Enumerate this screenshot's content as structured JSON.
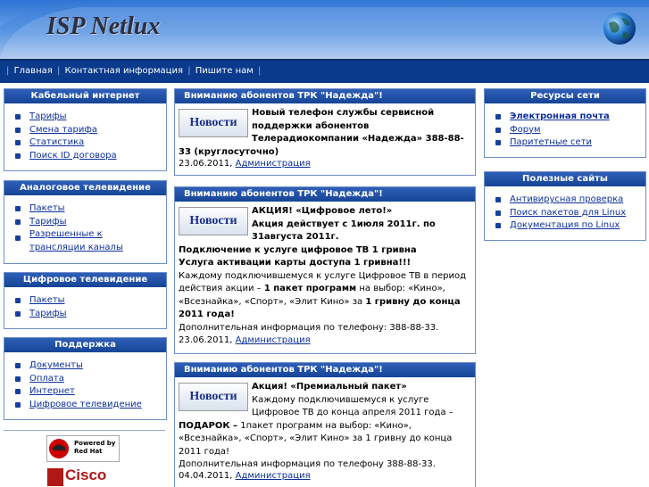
{
  "site": {
    "title": "ISP Netlux"
  },
  "nav": {
    "items": [
      "Главная",
      "Контактная информация",
      "Пишите нам"
    ]
  },
  "left_boxes": [
    {
      "title": "Кабельный интернет",
      "items": [
        "Тарифы",
        "Смена тарифа",
        "Статистика",
        "Поиск ID договора"
      ]
    },
    {
      "title": "Аналоговое телевидение",
      "items": [
        "Пакеты",
        "Тарифы",
        "Разрешенные к трансляции каналы"
      ]
    },
    {
      "title": "Цифровое телевидение",
      "items": [
        "Пакеты",
        "Тарифы"
      ]
    },
    {
      "title": "Поддержка",
      "items": [
        "Документы",
        "Оплата",
        "Интернет",
        "Цифровое телевидение"
      ]
    }
  ],
  "right_boxes": [
    {
      "title": "Ресурсы сети",
      "items": [
        "Электронная почта",
        "Форум",
        "Паритетные сети"
      ]
    },
    {
      "title": "Полезные сайты",
      "items": [
        "Антивирусная проверка",
        "Поиск пакетов для Linux",
        "Документация по Linux"
      ]
    }
  ],
  "badges": {
    "redhat": "Powered by Red Hat",
    "cisco": "Cisco"
  },
  "news_image_label": "Новости",
  "news": [
    {
      "header": "Вниманию абонентов ТРК \"Надежда\"!",
      "lines": [
        "Новый телефон службы сервисной поддержки абонентов Телерадиокомпании «Надежда» 388-88-33 (круглосуточно)"
      ],
      "date": "23.06.2011",
      "author": "Администрация"
    },
    {
      "header": "Вниманию абонентов ТРК \"Надежда\"!",
      "head_lines": [
        "АКЦИЯ! «Цифровое лето!»",
        "Акция действует с 1июля 2011г. по 31августа 2011г."
      ],
      "bold_lines": [
        "Подключение к услуге цифровое ТВ 1 гривна",
        "Услуга активации карты доступа 1 гривна!!!"
      ],
      "text_1": "Каждому подключившемуся к услуге Цифровое ТВ в период действия акции –",
      "text_1b": "1 пакет программ",
      "text_2": "на выбор: «Кино», «Всезнайка», «Спорт», «Элит Кино» за",
      "text_2b": "1 гривну до конца 2011 года!",
      "text_3": "Дополнительная информация по телефону: 388-88-33.",
      "date": "23.06.2011",
      "author": "Администрация"
    },
    {
      "header": "Вниманию абонентов ТРК \"Надежда\"!",
      "head_line": "Акция! «Премиальный пакет»",
      "text_1": "Каждому подключившемуся к услуге Цифровое ТВ до конца апреля 2011 года –",
      "text_1b": "ПОДАРОК –",
      "text_2": "1пакет программ на выбор: «Кино», «Всезнайка», «Спорт», «Элит Кино» за 1 гривну до конца 2011 года!",
      "text_3": "Дополнительная информация по телефону 388-88-33.",
      "date": "04.04.2011",
      "author": "Администрация"
    }
  ],
  "colors": {
    "nav_bg": "#0a3a8c",
    "box_header": "#1f4fa6",
    "link": "#0b2f9c"
  }
}
